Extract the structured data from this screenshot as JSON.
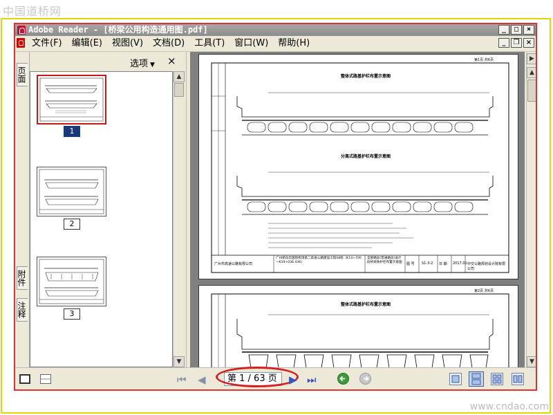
{
  "watermark": {
    "top": "中国道桥网",
    "bottom": "www.cndao.com"
  },
  "window": {
    "title": "Adobe Reader - [桥梁公用构造通用图.pdf]"
  },
  "menubar": {
    "items": [
      "文件(F)",
      "编辑(E)",
      "视图(V)",
      "文档(D)",
      "工具(T)",
      "窗口(W)",
      "帮助(H)"
    ]
  },
  "nav_tabs": {
    "pages": "页面",
    "attachments": "附件",
    "comments": "注释"
  },
  "thumbnail_pane": {
    "options_label": "选项",
    "close_label": "×",
    "thumbnails": [
      {
        "label": "1",
        "selected": true
      },
      {
        "label": "2",
        "selected": false
      },
      {
        "label": "3",
        "selected": false
      }
    ]
  },
  "document": {
    "page1": {
      "heading_top": "整体式路基护栏布置示意图",
      "heading_mid": "分离式路基护栏布置示意图",
      "corner_text": "第1页 共6页",
      "title_block": {
        "company": "广州市高速公路有限公司",
        "project": "广州新白云国际机场第二高速公路建设工程S8标（K14+700～K19+036.436）",
        "drawing_title": "全部路段(普通路段)设计段桥梁防护栏布置示意图",
        "figure_label": "图 号",
        "figure_no": "S1-3-2",
        "date_label": "日 期",
        "date": "2017.01",
        "designer": "中交公路规划设计院有限公司"
      }
    },
    "page2": {
      "heading_top": "整体式路基护栏布置示意图",
      "corner_text": "第2页 共6页"
    }
  },
  "statusbar": {
    "page_indicator": "第 1 / 63 页"
  },
  "colors": {
    "selection_border": "#c41818",
    "selection_label": "#163a7a",
    "annotation_ellipse": "#d61e1e",
    "frame": "#e8d200"
  }
}
